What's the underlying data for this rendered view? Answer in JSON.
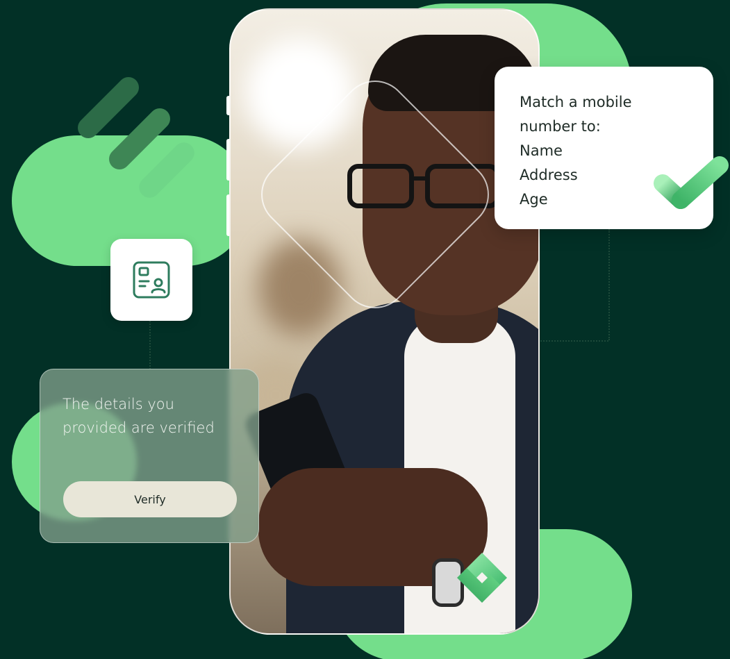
{
  "match_card": {
    "lines": [
      "Match a mobile",
      "number to:",
      "Name",
      "Address",
      "Age"
    ]
  },
  "verify_card": {
    "lines": [
      "The details you",
      "provided are verified"
    ],
    "button_label": "Verify"
  },
  "icons": {
    "check": "checkmark-icon",
    "id_badge": "id-card-icon",
    "logo": "brand-logo-icon"
  },
  "colors": {
    "background": "#023026",
    "accent_green": "#74DE8B",
    "card_white": "#FFFFFF",
    "verify_card": "#82A08C",
    "button": "#E8E6D8"
  }
}
